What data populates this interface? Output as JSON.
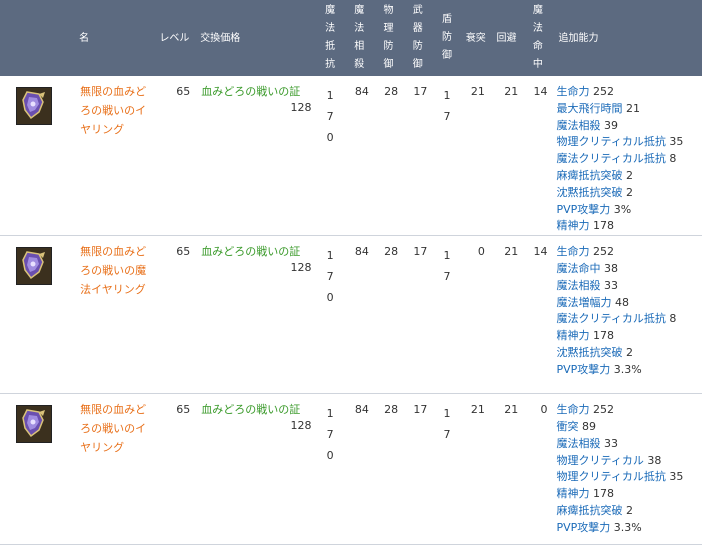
{
  "header": {
    "name": "名",
    "level": "レベル",
    "price": "交換価格",
    "magic_resist": "魔法抵抗",
    "magic_offset": "魔法相殺",
    "phys_def": "物理防御",
    "weapon_def": "武器防御",
    "shield_def": "盾防御",
    "parry": "衰突",
    "evasion": "回避",
    "magic_acc": "魔法命中",
    "bonus": "追加能力"
  },
  "items": [
    {
      "icon": "purple-earring-icon",
      "name": "無限の血みどろの戦いのイヤリング",
      "level": "65",
      "price_item": "血みどろの戦いの証",
      "price_count": "128",
      "magic_resist": "170",
      "magic_offset": "84",
      "phys_def": "28",
      "weapon_def": "17",
      "shield_def": "17",
      "parry": "21",
      "evasion": "21",
      "magic_acc": "14",
      "effects": [
        {
          "name": "生命力",
          "value": "252"
        },
        {
          "name": "最大飛行時間",
          "value": "21"
        },
        {
          "name": "魔法相殺",
          "value": "39"
        },
        {
          "name": "物理クリティカル抵抗",
          "value": "35"
        },
        {
          "name": "魔法クリティカル抵抗",
          "value": "8"
        },
        {
          "name": "麻痺抵抗突破",
          "value": "2"
        },
        {
          "name": "沈黙抵抗突破",
          "value": "2"
        },
        {
          "name": "PVP攻撃力",
          "value": "3%"
        },
        {
          "name": "精神力",
          "value": "178"
        }
      ]
    },
    {
      "icon": "purple-earring-icon",
      "name": "無限の血みどろの戦いの魔法イヤリング",
      "level": "65",
      "price_item": "血みどろの戦いの証",
      "price_count": "128",
      "magic_resist": "170",
      "magic_offset": "84",
      "phys_def": "28",
      "weapon_def": "17",
      "shield_def": "17",
      "parry": "0",
      "evasion": "21",
      "magic_acc": "14",
      "effects": [
        {
          "name": "生命力",
          "value": "252"
        },
        {
          "name": "魔法命中",
          "value": "38"
        },
        {
          "name": "魔法相殺",
          "value": "33"
        },
        {
          "name": "魔法増幅力",
          "value": "48"
        },
        {
          "name": "魔法クリティカル抵抗",
          "value": "8"
        },
        {
          "name": "精神力",
          "value": "178"
        },
        {
          "name": "沈黙抵抗突破",
          "value": "2"
        },
        {
          "name": "PVP攻撃力",
          "value": "3.3%"
        }
      ]
    },
    {
      "icon": "purple-earring-icon",
      "name": "無限の血みどろの戦いのイヤリング",
      "level": "65",
      "price_item": "血みどろの戦いの証",
      "price_count": "128",
      "magic_resist": "170",
      "magic_offset": "84",
      "phys_def": "28",
      "weapon_def": "17",
      "shield_def": "17",
      "parry": "21",
      "evasion": "21",
      "magic_acc": "0",
      "effects": [
        {
          "name": "生命力",
          "value": "252"
        },
        {
          "name": "衝突",
          "value": "89"
        },
        {
          "name": "魔法相殺",
          "value": "33"
        },
        {
          "name": "物理クリティカル",
          "value": "38"
        },
        {
          "name": "物理クリティカル抵抗",
          "value": "35"
        },
        {
          "name": "精神力",
          "value": "178"
        },
        {
          "name": "麻痺抵抗突破",
          "value": "2"
        },
        {
          "name": "PVP攻撃力",
          "value": "3.3%"
        }
      ]
    }
  ]
}
